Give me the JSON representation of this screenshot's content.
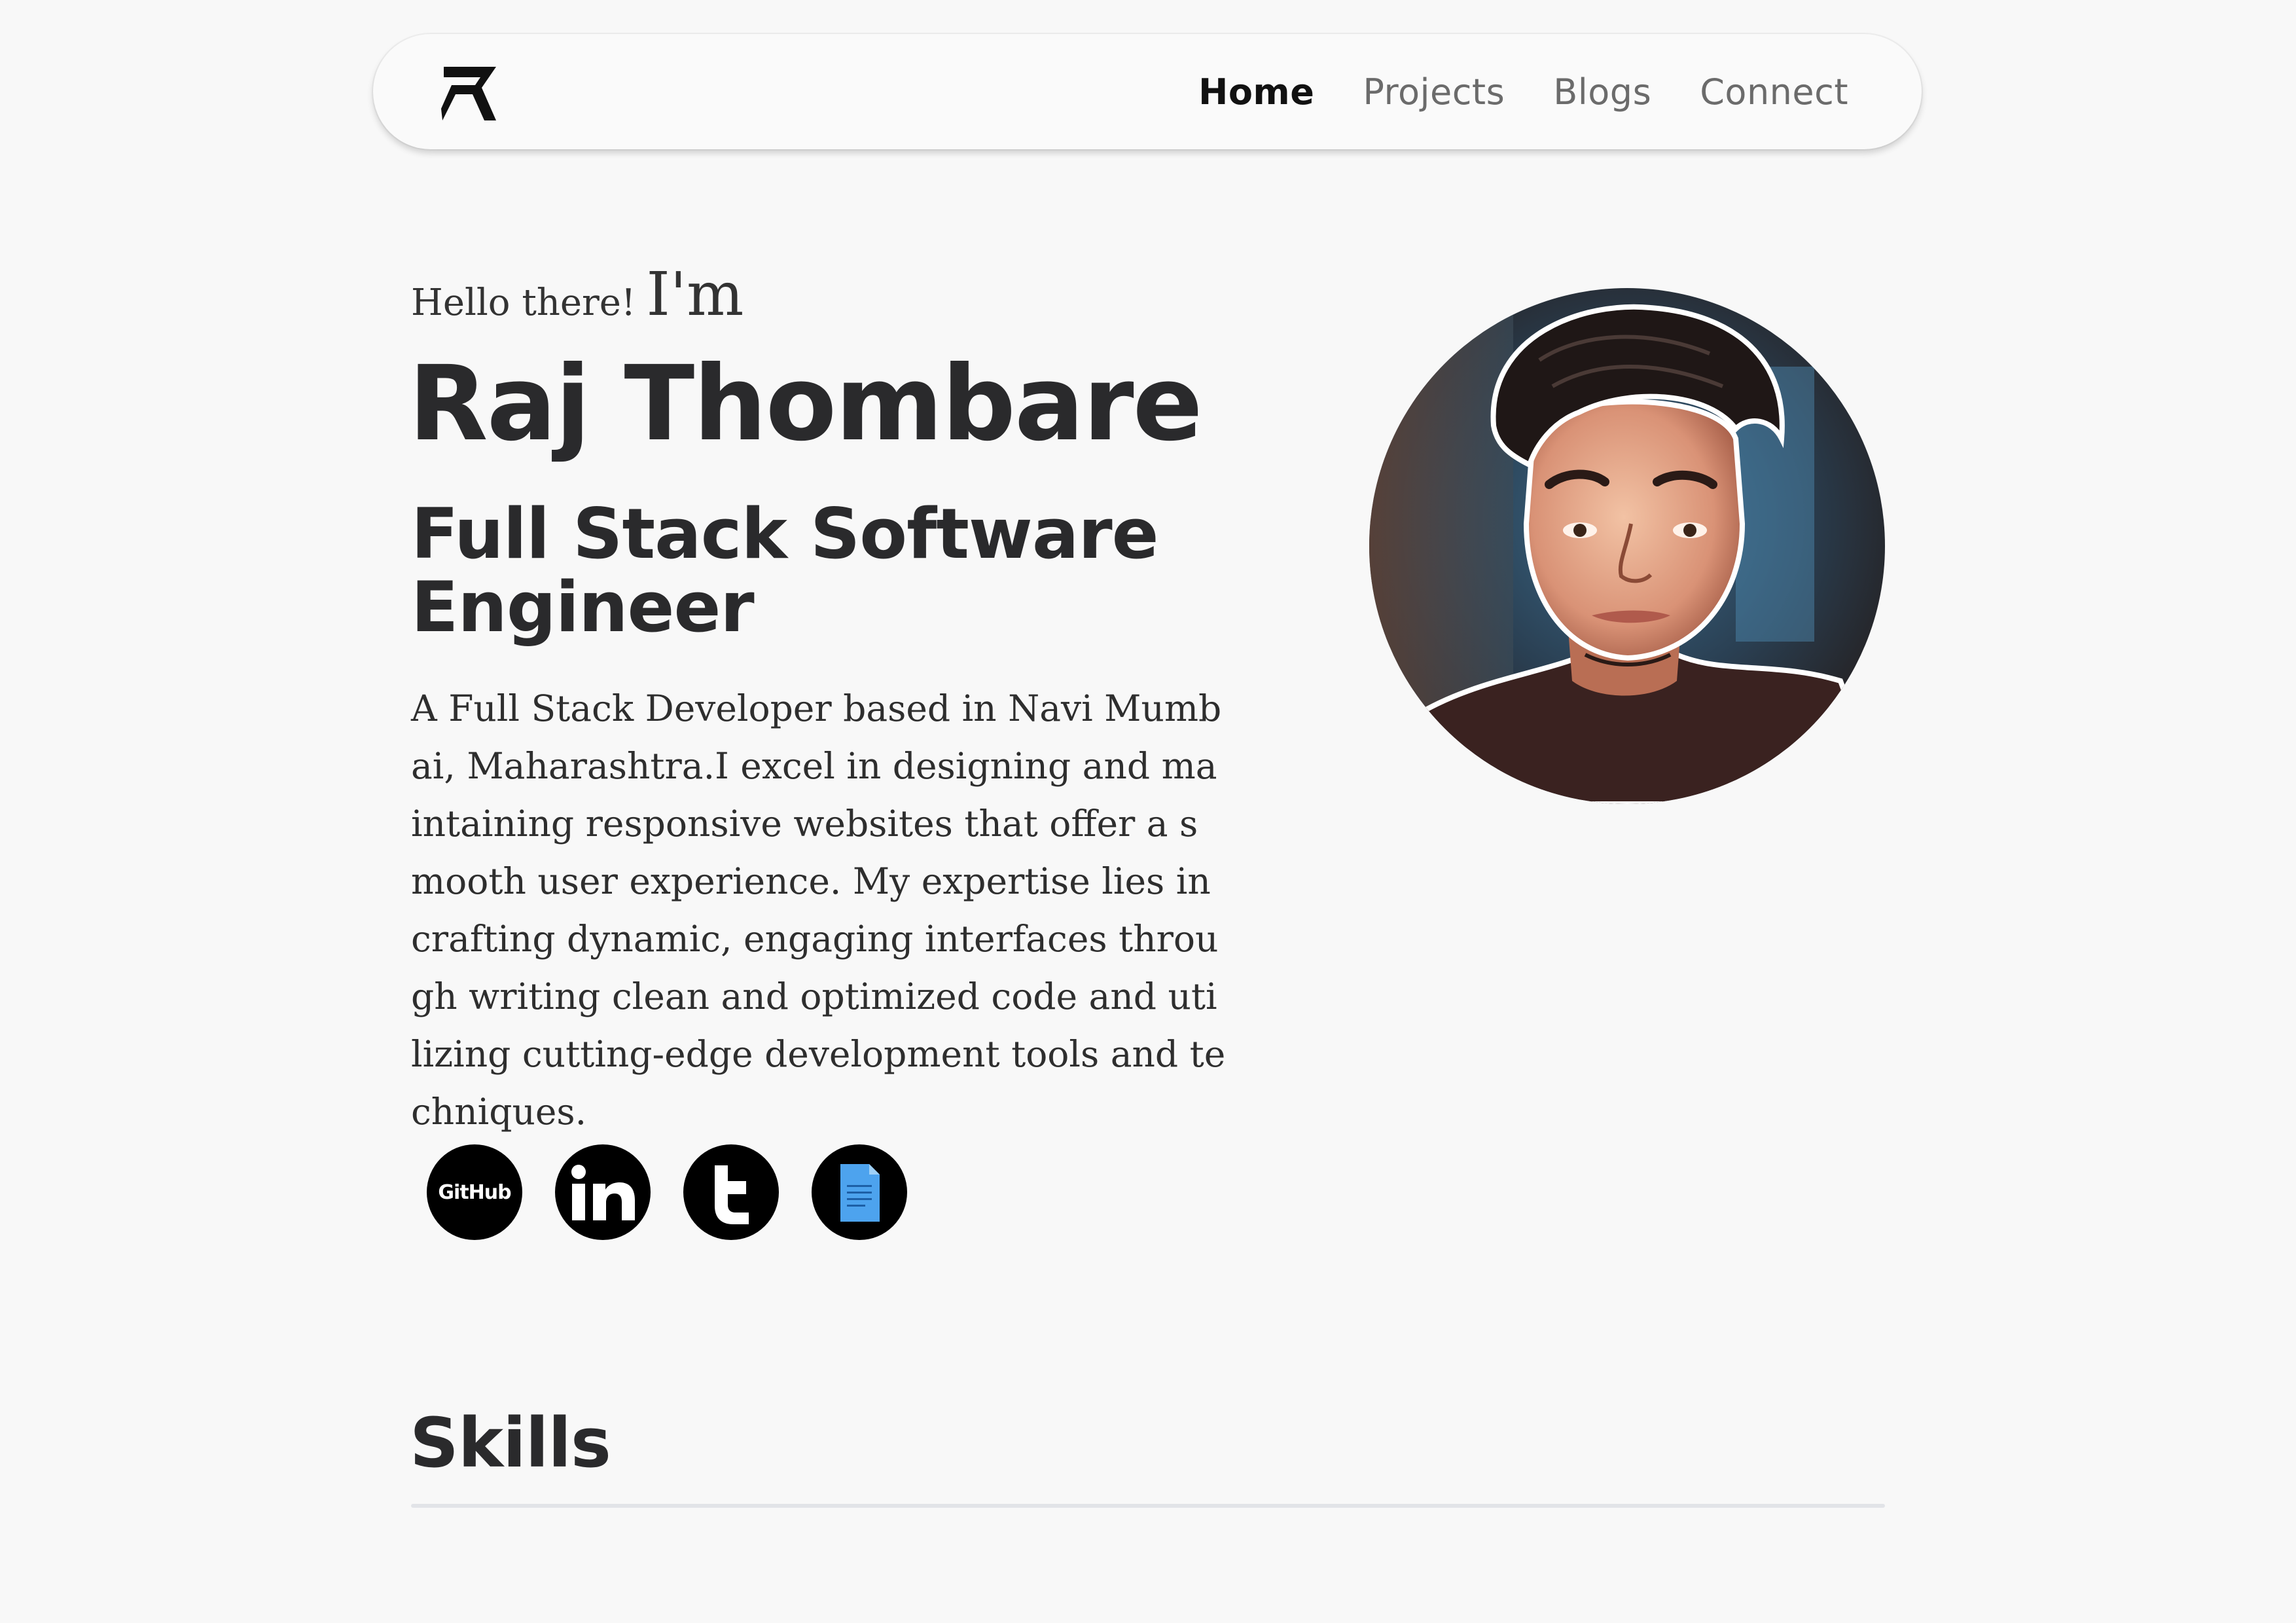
{
  "nav": {
    "logo_icon": "rt-logo-icon",
    "links": [
      {
        "label": "Home",
        "active": true
      },
      {
        "label": "Projects",
        "active": false
      },
      {
        "label": "Blogs",
        "active": false
      },
      {
        "label": "Connect",
        "active": false
      }
    ]
  },
  "hero": {
    "greeting": "Hello there!",
    "greeting_im": "I'm",
    "name": "Raj Thombare",
    "role": "Full Stack Software Engineer",
    "bio": "A Full Stack Developer based in Navi Mumbai, Maharashtra.I excel in designing and maintaining responsive websites that offer a smooth user experience. My expertise lies in crafting dynamic, engaging interfaces through writing clean and optimized code and utilizing cutting-edge development tools and techniques."
  },
  "socials": [
    {
      "icon": "github-icon",
      "label": "GitHub"
    },
    {
      "icon": "linkedin-icon",
      "label": "in"
    },
    {
      "icon": "tumblr-icon",
      "label": "t"
    },
    {
      "icon": "resume-document-icon",
      "label": ""
    }
  ],
  "skills": {
    "title": "Skills"
  },
  "colors": {
    "background": "#f8f8f8",
    "nav_bg": "#fafafa",
    "heading": "#2a2a2c",
    "nav_inactive": "#6b6b6b",
    "social_bg": "#000000",
    "doc_icon": "#4da3ee"
  }
}
